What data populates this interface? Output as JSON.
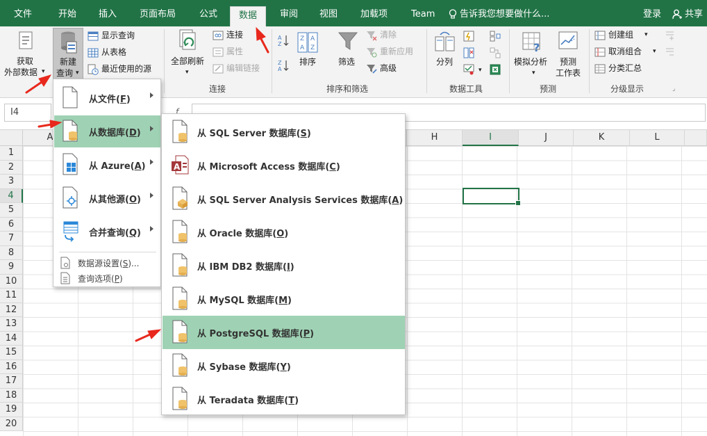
{
  "tabs": [
    "文件",
    "开始",
    "插入",
    "页面布局",
    "公式",
    "数据",
    "审阅",
    "视图",
    "加载项",
    "Team"
  ],
  "active_tab": "数据",
  "tell_me": "告诉我您想要做什么...",
  "login": "登录",
  "share": "共享",
  "ribbon": {
    "get_external_1": "获取",
    "get_external_2": "外部数据",
    "new_query_1": "新建",
    "new_query_2": "查询",
    "show_queries": "显示查询",
    "from_table": "从表格",
    "recent_sources": "最近使用的源",
    "refresh_all": "全部刷新",
    "connections": "连接",
    "properties": "属性",
    "edit_links": "编辑链接",
    "group_connections": "连接",
    "sort": "排序",
    "filter": "筛选",
    "clear": "清除",
    "reapply": "重新应用",
    "advanced": "高级",
    "group_sort_filter": "排序和筛选",
    "text_to_columns": "分列",
    "group_data_tools": "数据工具",
    "what_if": "模拟分析",
    "forecast_sheet_1": "预测",
    "forecast_sheet_2": "工作表",
    "group_forecast": "预测",
    "group_create": "创建组",
    "ungroup": "取消组合",
    "subtotal": "分类汇总",
    "group_outline": "分级显示"
  },
  "name_box": "I4",
  "fx_label": "f",
  "columns": [
    "A",
    "H",
    "I",
    "J",
    "K",
    "L"
  ],
  "rows": [
    "1",
    "2",
    "3",
    "4",
    "5",
    "6",
    "7",
    "8",
    "9",
    "10",
    "11",
    "12",
    "13",
    "14",
    "15",
    "16",
    "17",
    "18",
    "19",
    "20"
  ],
  "menu1": {
    "items": [
      {
        "label": "从文件(",
        "key": "F",
        "suffix": ")"
      },
      {
        "label": "从数据库(",
        "key": "D",
        "suffix": ")"
      },
      {
        "label": "从 Azure(",
        "key": "A",
        "suffix": ")"
      },
      {
        "label": "从其他源(",
        "key": "O",
        "suffix": ")"
      },
      {
        "label": "合并查询(",
        "key": "Q",
        "suffix": ")"
      }
    ],
    "data_source_settings": {
      "label": "数据源设置(",
      "key": "S",
      "suffix": ")..."
    },
    "query_options": {
      "label": "查询选项(",
      "key": "P",
      "suffix": ")"
    }
  },
  "menu2": {
    "items": [
      {
        "label": "从 SQL Server 数据库(",
        "key": "S",
        "suffix": ")"
      },
      {
        "label": "从 Microsoft Access 数据库(",
        "key": "C",
        "suffix": ")"
      },
      {
        "label": "从 SQL Server Analysis Services 数据库(",
        "key": "A",
        "suffix": ")"
      },
      {
        "label": "从 Oracle 数据库(",
        "key": "O",
        "suffix": ")"
      },
      {
        "label": "从 IBM DB2 数据库(",
        "key": "I",
        "suffix": ")"
      },
      {
        "label": "从 MySQL 数据库(",
        "key": "M",
        "suffix": ")"
      },
      {
        "label": "从 PostgreSQL 数据库(",
        "key": "P",
        "suffix": ")"
      },
      {
        "label": "从 Sybase 数据库(",
        "key": "Y",
        "suffix": ")"
      },
      {
        "label": "从 Teradata 数据库(",
        "key": "T",
        "suffix": ")"
      }
    ]
  },
  "colors": {
    "accent": "#217346",
    "highlight": "#9fd2b4",
    "annotation": "#e8281d"
  }
}
